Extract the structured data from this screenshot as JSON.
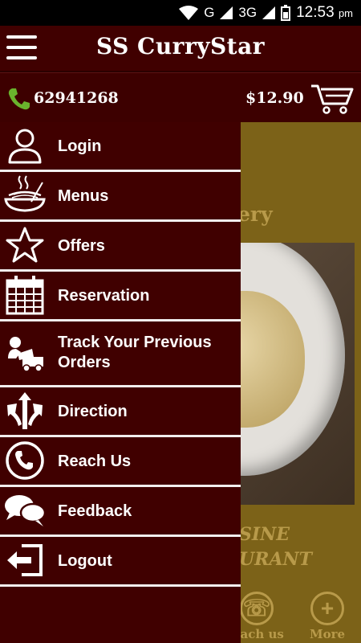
{
  "status_bar": {
    "network_label": "G",
    "network_type": "3G",
    "time": "12:53",
    "time_suffix": "pm"
  },
  "app_bar": {
    "title": "SS CurryStar"
  },
  "info_bar": {
    "phone": "62941268",
    "cart_total": "$12.90"
  },
  "drawer": {
    "items": [
      {
        "label": "Login",
        "icon": "user-icon"
      },
      {
        "label": "Menus",
        "icon": "bowl-icon"
      },
      {
        "label": "Offers",
        "icon": "star-icon"
      },
      {
        "label": "Reservation",
        "icon": "calendar-icon"
      },
      {
        "label": "Track Your Previous Orders",
        "icon": "delivery-truck-icon"
      },
      {
        "label": "Direction",
        "icon": "direction-arrows-icon"
      },
      {
        "label": "Reach Us",
        "icon": "phone-circle-icon"
      },
      {
        "label": "Feedback",
        "icon": "chat-bubbles-icon"
      },
      {
        "label": "Logout",
        "icon": "logout-icon"
      }
    ]
  },
  "background": {
    "heading": "ery",
    "tagline_1": "SINE",
    "tagline_2": "URANT",
    "nav_reach_label": "each us",
    "nav_more_label": "More"
  },
  "colors": {
    "primary": "#400000",
    "accent_green": "#6ab42d",
    "background_gold": "#7c6218"
  }
}
